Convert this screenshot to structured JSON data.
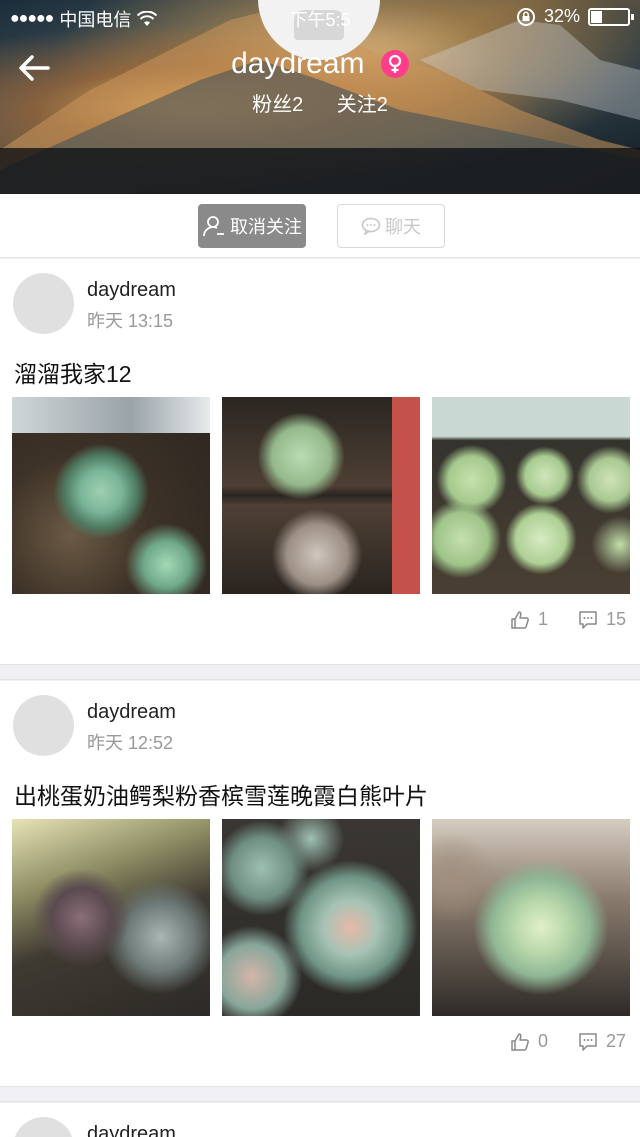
{
  "status_bar": {
    "signal": "●●●●●",
    "carrier": "中国电信",
    "time": "下午5:5",
    "battery": "32%"
  },
  "profile": {
    "name": "daydream",
    "fans": "粉丝2",
    "following": "关注2"
  },
  "actions": {
    "unfollow_label": "取消关注",
    "chat_label": "聊天"
  },
  "posts": [
    {
      "author": "daydream",
      "time": "昨天 13:15",
      "text": "溜溜我家12",
      "likes": "1",
      "comments": "15"
    },
    {
      "author": "daydream",
      "time": "昨天 12:52",
      "text": "出桃蛋奶油鳄梨粉香槟雪莲晚霞白熊叶片",
      "likes": "0",
      "comments": "27"
    },
    {
      "author": "daydream"
    }
  ],
  "icons": {
    "back": "back-arrow-icon",
    "gender": "female-icon",
    "like": "thumbs-up-icon",
    "comment": "comment-icon",
    "unfollow": "person-icon",
    "chat": "chat-bubble-icon"
  },
  "colors": {
    "gender_badge": "#ff3d8a",
    "unfollow_bg": "#8a8a8a"
  }
}
